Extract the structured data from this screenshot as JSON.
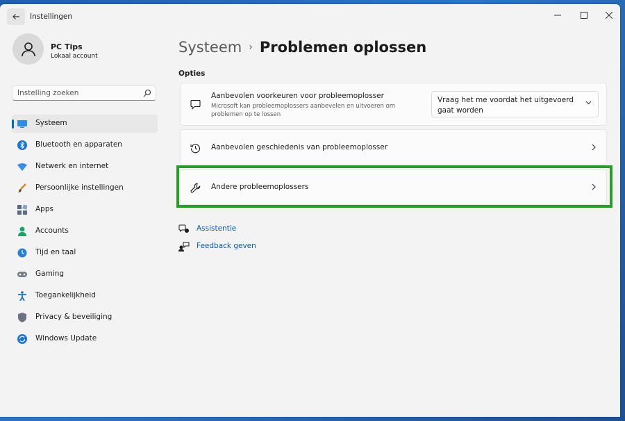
{
  "window": {
    "title": "Instellingen"
  },
  "profile": {
    "name": "PC Tips",
    "account_type": "Lokaal account"
  },
  "search": {
    "placeholder": "Instelling zoeken"
  },
  "sidebar": {
    "items": [
      {
        "label": "Systeem",
        "icon": "system-icon",
        "selected": true
      },
      {
        "label": "Bluetooth en apparaten",
        "icon": "bluetooth-icon"
      },
      {
        "label": "Netwerk en internet",
        "icon": "wifi-icon"
      },
      {
        "label": "Persoonlijke instellingen",
        "icon": "brush-icon"
      },
      {
        "label": "Apps",
        "icon": "apps-icon"
      },
      {
        "label": "Accounts",
        "icon": "accounts-icon"
      },
      {
        "label": "Tijd en taal",
        "icon": "globe-clock-icon"
      },
      {
        "label": "Gaming",
        "icon": "gamepad-icon"
      },
      {
        "label": "Toegankelijkheid",
        "icon": "accessibility-icon"
      },
      {
        "label": "Privacy & beveiliging",
        "icon": "shield-icon"
      },
      {
        "label": "Windows Update",
        "icon": "update-icon"
      }
    ]
  },
  "breadcrumb": {
    "parent": "Systeem",
    "separator": "›",
    "current": "Problemen oplossen"
  },
  "main": {
    "section_label": "Opties",
    "cards": [
      {
        "title": "Aanbevolen voorkeuren voor probleemoplosser",
        "description": "Microsoft kan probleemoplossers aanbevelen en uitvoeren om problemen op te lossen",
        "dropdown_value": "Vraag het me voordat het uitgevoerd gaat worden"
      },
      {
        "title": "Aanbevolen geschiedenis van probleemoplosser"
      },
      {
        "title": "Andere probleemoplossers"
      }
    ],
    "links": [
      {
        "label": "Assistentie"
      },
      {
        "label": "Feedback geven"
      }
    ]
  },
  "colors": {
    "accent": "#0067c0",
    "highlight": "#2b9a2b",
    "link": "#0a5bb5"
  }
}
